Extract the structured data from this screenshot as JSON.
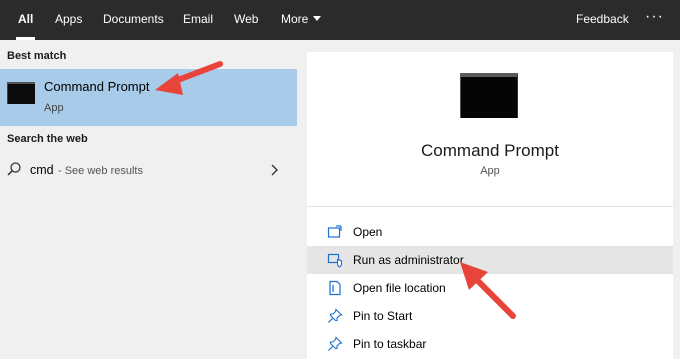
{
  "topbar": {
    "tabs": [
      {
        "label": "All"
      },
      {
        "label": "Apps"
      },
      {
        "label": "Documents"
      },
      {
        "label": "Email"
      },
      {
        "label": "Web"
      },
      {
        "label": "More"
      }
    ],
    "feedback_label": "Feedback",
    "more_options": "···"
  },
  "left": {
    "best_match_heading": "Best match",
    "best_match": {
      "title": "Command Prompt",
      "subtitle": "App"
    },
    "search_web_heading": "Search the web",
    "web_result": {
      "query": "cmd",
      "hint": "- See web results"
    }
  },
  "right": {
    "app_title": "Command Prompt",
    "app_subtitle": "App",
    "actions": [
      {
        "label": "Open",
        "icon": "open-window-icon"
      },
      {
        "label": "Run as administrator",
        "icon": "shield-admin-icon"
      },
      {
        "label": "Open file location",
        "icon": "file-location-icon"
      },
      {
        "label": "Pin to Start",
        "icon": "pin-icon"
      },
      {
        "label": "Pin to taskbar",
        "icon": "pin-icon"
      }
    ]
  },
  "colors": {
    "topbar_bg": "#2b2b2b",
    "selected_bg": "#a9cbea",
    "hover_bg": "#e5e5e5",
    "icon_accent": "#1a6fd1",
    "annotation_arrow": "#e8443a"
  }
}
